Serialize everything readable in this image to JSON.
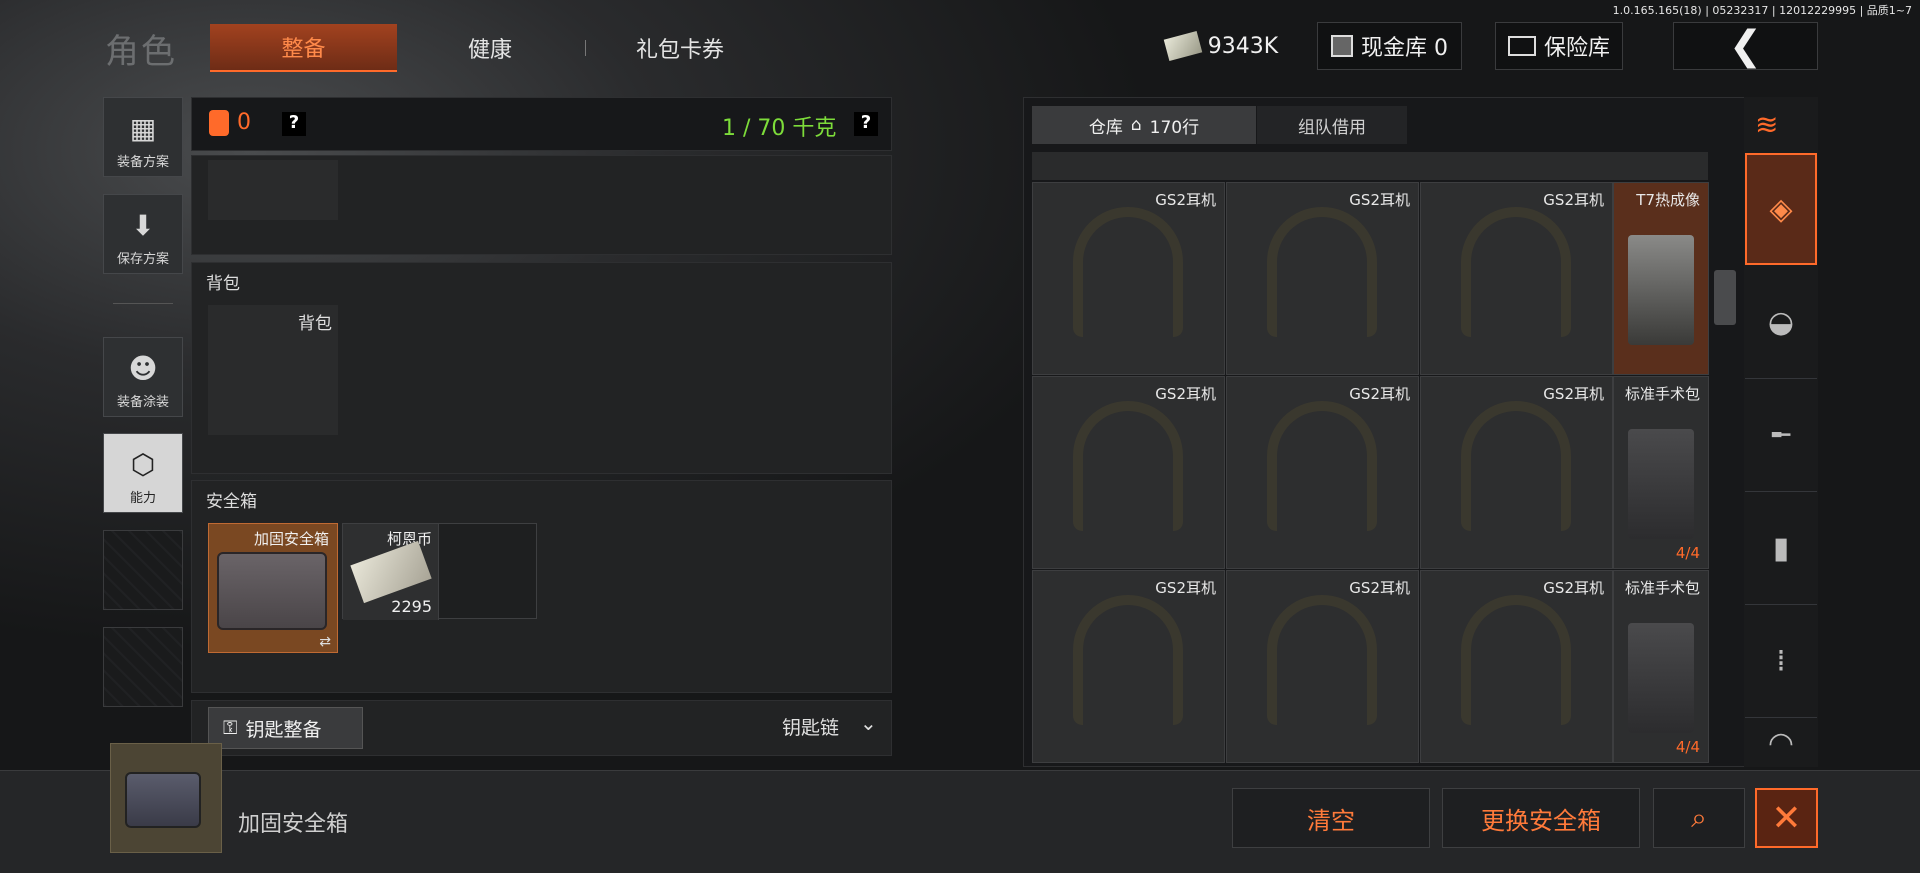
{
  "version": "1.0.165.165(18) | 05232317 | 12012229995 | 品质1~7",
  "header": {
    "title": "角色",
    "tabs": [
      {
        "label": "整备",
        "active": true
      },
      {
        "label": "健康",
        "active": false
      },
      {
        "label": "礼包卡券",
        "active": false
      }
    ],
    "money": "9343K",
    "cash_vault": "现金库 0",
    "safe_vault": "保险库",
    "back_icon": "chevron-left-icon"
  },
  "sidebar": {
    "items": [
      {
        "label": "装备方案",
        "icon": "vest-icon"
      },
      {
        "label": "保存方案",
        "icon": "download-icon"
      },
      {
        "label": "装备涂装",
        "icon": "helmet-icon"
      },
      {
        "label": "能力",
        "icon": "hex-bolt-icon"
      }
    ]
  },
  "loadout": {
    "armor_count": "0",
    "help": "?",
    "weight": "1 / 70 千克",
    "backpack_section": "背包",
    "backpack_slot": "背包",
    "safe_section": "安全箱",
    "safe_item": "加固安全箱",
    "coin_item": "柯恩币",
    "coin_count": "2295",
    "key_button": "钥匙整备",
    "key_chain": "钥匙链"
  },
  "warehouse": {
    "tab_storage": "仓库",
    "rows": "170行",
    "tab_team": "组队借用",
    "items": [
      {
        "label": "GS2耳机"
      },
      {
        "label": "GS2耳机"
      },
      {
        "label": "GS2耳机"
      },
      {
        "label": "T7热成像",
        "count": ""
      },
      {
        "label": "GS2耳机"
      },
      {
        "label": "GS2耳机"
      },
      {
        "label": "GS2耳机"
      },
      {
        "label": "标准手术包",
        "count": "4/4"
      },
      {
        "label": "GS2耳机"
      },
      {
        "label": "GS2耳机"
      },
      {
        "label": "GS2耳机"
      },
      {
        "label": "标准手术包",
        "count": "4/4"
      }
    ]
  },
  "bottom": {
    "selected_name": "加固安全箱",
    "clear": "清空",
    "replace": "更换安全箱"
  },
  "colors": {
    "accent": "#ff6a2a",
    "weight_green": "#7ddc3a"
  }
}
